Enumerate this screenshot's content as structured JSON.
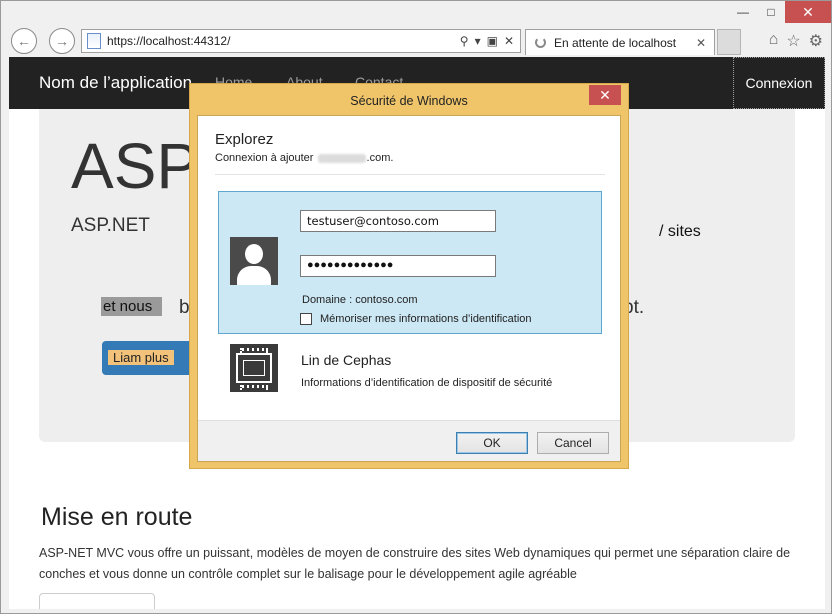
{
  "browser": {
    "address_url": "https://localhost:44312/",
    "tab_title": "En attente de localhost",
    "icons": [
      "back-icon",
      "forward-icon",
      "page-icon",
      "search-icon",
      "dropdown-icon",
      "lock-icon",
      "close-icon",
      "home-icon",
      "star-icon",
      "gear-icon"
    ]
  },
  "site": {
    "brand": "Nom de l’application",
    "nav": [
      "Home",
      "About",
      "Contact"
    ],
    "login": "Connexion",
    "heading": "ASP",
    "lead_start": "ASP.NET",
    "lead_end": "/ sites",
    "lead2_highlight": "et nous",
    "lead2_b": "b",
    "lead2_end": "pt.",
    "learn_more": "Liam plus",
    "section_title": "Mise en route",
    "section_text": "ASP-NET MVC vous offre un puissant, modèles de moyen de construire des sites Web dynamiques qui permet une séparation claire de conches et vous donne un contrôle complet sur le balisage pour le développement agile agréable"
  },
  "dialog": {
    "title": "Sécurité de Windows",
    "app_name": "Explorez",
    "subtitle_prefix": "Connexion à ajouter",
    "subtitle_suffix": ".com.",
    "username": "testuser@contoso.com",
    "password_mask": "●●●●●●●●●●●●●",
    "domain": "Domaine : contoso.com",
    "remember": "Mémoriser mes informations d’identification",
    "alt_name": "Lin de Cephas",
    "alt_desc": "Informations d’identification de dispositif de sécurité",
    "ok": "OK",
    "cancel": "Cancel"
  }
}
